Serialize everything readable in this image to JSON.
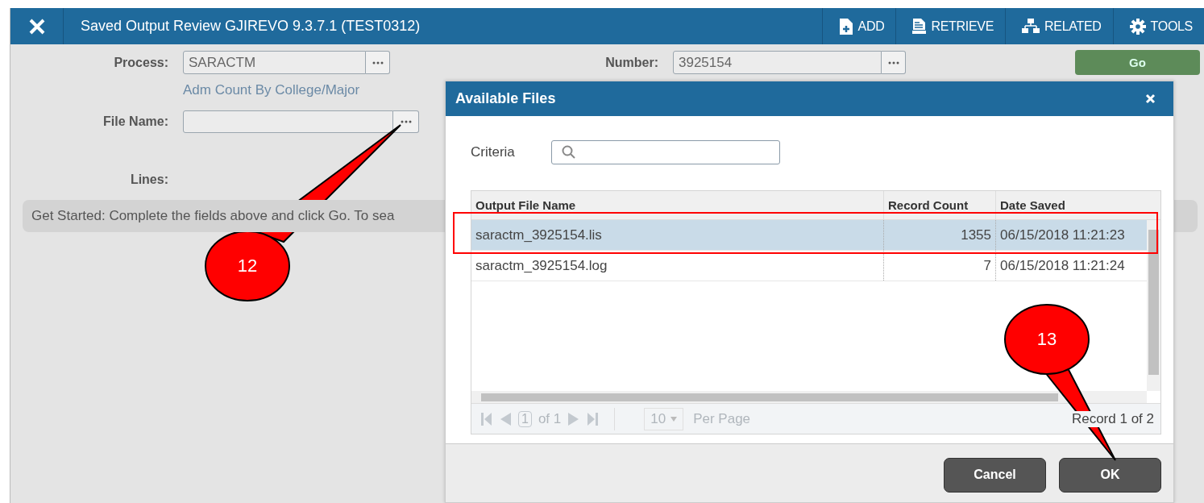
{
  "window": {
    "title": "Saved Output Review GJIREVO 9.3.7.1 (TEST0312)"
  },
  "toolbar": [
    {
      "label": "ADD",
      "kind": "add"
    },
    {
      "label": "RETRIEVE",
      "kind": "retrieve"
    },
    {
      "label": "RELATED",
      "kind": "related"
    },
    {
      "label": "TOOLS",
      "kind": "tools"
    }
  ],
  "form": {
    "process": {
      "label": "Process:",
      "value": "SARACTM",
      "description": "Adm Count By College/Major"
    },
    "number": {
      "label": "Number:",
      "value": "3925154"
    },
    "file_name": {
      "label": "File Name:"
    },
    "lines": {
      "label": "Lines:"
    },
    "go_button": "Go",
    "message": "Get Started: Complete the fields above and click Go. To sea"
  },
  "dialog": {
    "title": "Available Files",
    "criteria_label": "Criteria",
    "columns": [
      "Output File Name",
      "Record Count",
      "Date Saved"
    ],
    "rows": [
      {
        "cells": [
          "saractm_3925154.lis",
          "1355",
          "06/15/2018 11:21:23"
        ],
        "selected": true,
        "outlined": true
      },
      {
        "cells": [
          "saractm_3925154.log",
          "7",
          "06/15/2018 11:21:24"
        ],
        "selected": false,
        "outlined": false
      }
    ],
    "pager": {
      "page": "1",
      "of": "of 1",
      "page_size": "10",
      "per_page": "Per Page",
      "record": "Record 1 of 2"
    },
    "buttons": [
      "Cancel",
      "OK"
    ]
  },
  "callouts": [
    {
      "label": "12"
    },
    {
      "label": "13"
    }
  ]
}
